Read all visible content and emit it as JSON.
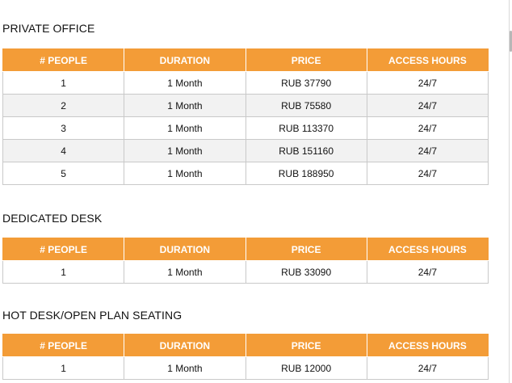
{
  "columns": [
    "# PEOPLE",
    "DURATION",
    "PRICE",
    "ACCESS HOURS"
  ],
  "sections": [
    {
      "title": "PRIVATE OFFICE",
      "rows": [
        [
          "1",
          "1 Month",
          "RUB 37790",
          "24/7"
        ],
        [
          "2",
          "1 Month",
          "RUB 75580",
          "24/7"
        ],
        [
          "3",
          "1 Month",
          "RUB 113370",
          "24/7"
        ],
        [
          "4",
          "1 Month",
          "RUB 151160",
          "24/7"
        ],
        [
          "5",
          "1 Month",
          "RUB 188950",
          "24/7"
        ]
      ]
    },
    {
      "title": "DEDICATED DESK",
      "rows": [
        [
          "1",
          "1 Month",
          "RUB 33090",
          "24/7"
        ]
      ]
    },
    {
      "title": "HOT DESK/OPEN PLAN SEATING",
      "rows": [
        [
          "1",
          "1 Month",
          "RUB 12000",
          "24/7"
        ]
      ]
    }
  ],
  "colors": {
    "header_background": "#f39c37",
    "header_text": "#ffffff",
    "row_stripe": "#f2f2f2",
    "border": "#c9c9c9"
  }
}
